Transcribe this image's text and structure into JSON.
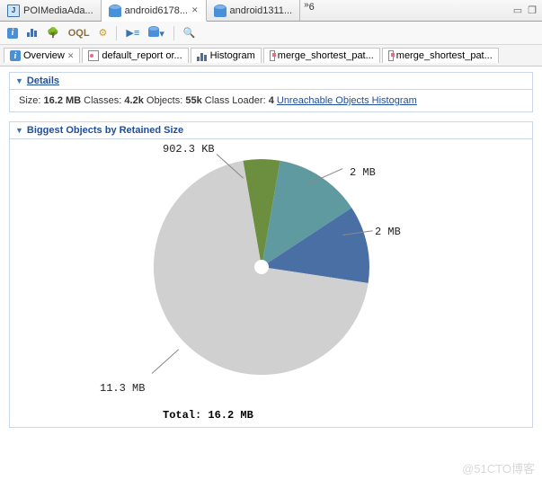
{
  "top_tabs": {
    "t0": "POIMediaAda...",
    "t1": "android6178...",
    "t2": "android1311...",
    "overflow_count": "6"
  },
  "inner_tabs": {
    "t0": "Overview",
    "t1": "default_report  or...",
    "t2": "Histogram",
    "t3": "merge_shortest_pat...",
    "t4": "merge_shortest_pat..."
  },
  "sections": {
    "details_title": "Details",
    "biggest_title": "Biggest Objects by Retained Size"
  },
  "details": {
    "size_label": "Size:",
    "size_value": "16.2 MB",
    "classes_label": "Classes:",
    "classes_value": "4.2k",
    "objects_label": "Objects:",
    "objects_value": "55k",
    "loader_label": "Class Loader:",
    "loader_value": "4",
    "link_text": "Unreachable Objects Histogram"
  },
  "chart_data": {
    "type": "pie",
    "title": "Biggest Objects by Retained Size",
    "total_label": "Total: 16.2 MB",
    "slices": [
      {
        "label": "902.3 KB",
        "value_mb": 0.9,
        "color": "#6b8e3f"
      },
      {
        "label": "2 MB",
        "value_mb": 2.0,
        "color": "#5e9aa0"
      },
      {
        "label": "2 MB",
        "value_mb": 2.0,
        "color": "#4a6fa5"
      },
      {
        "label": "11.3 MB",
        "value_mb": 11.3,
        "color": "#d0d0d0"
      }
    ]
  },
  "watermark": "@51CTO博客"
}
